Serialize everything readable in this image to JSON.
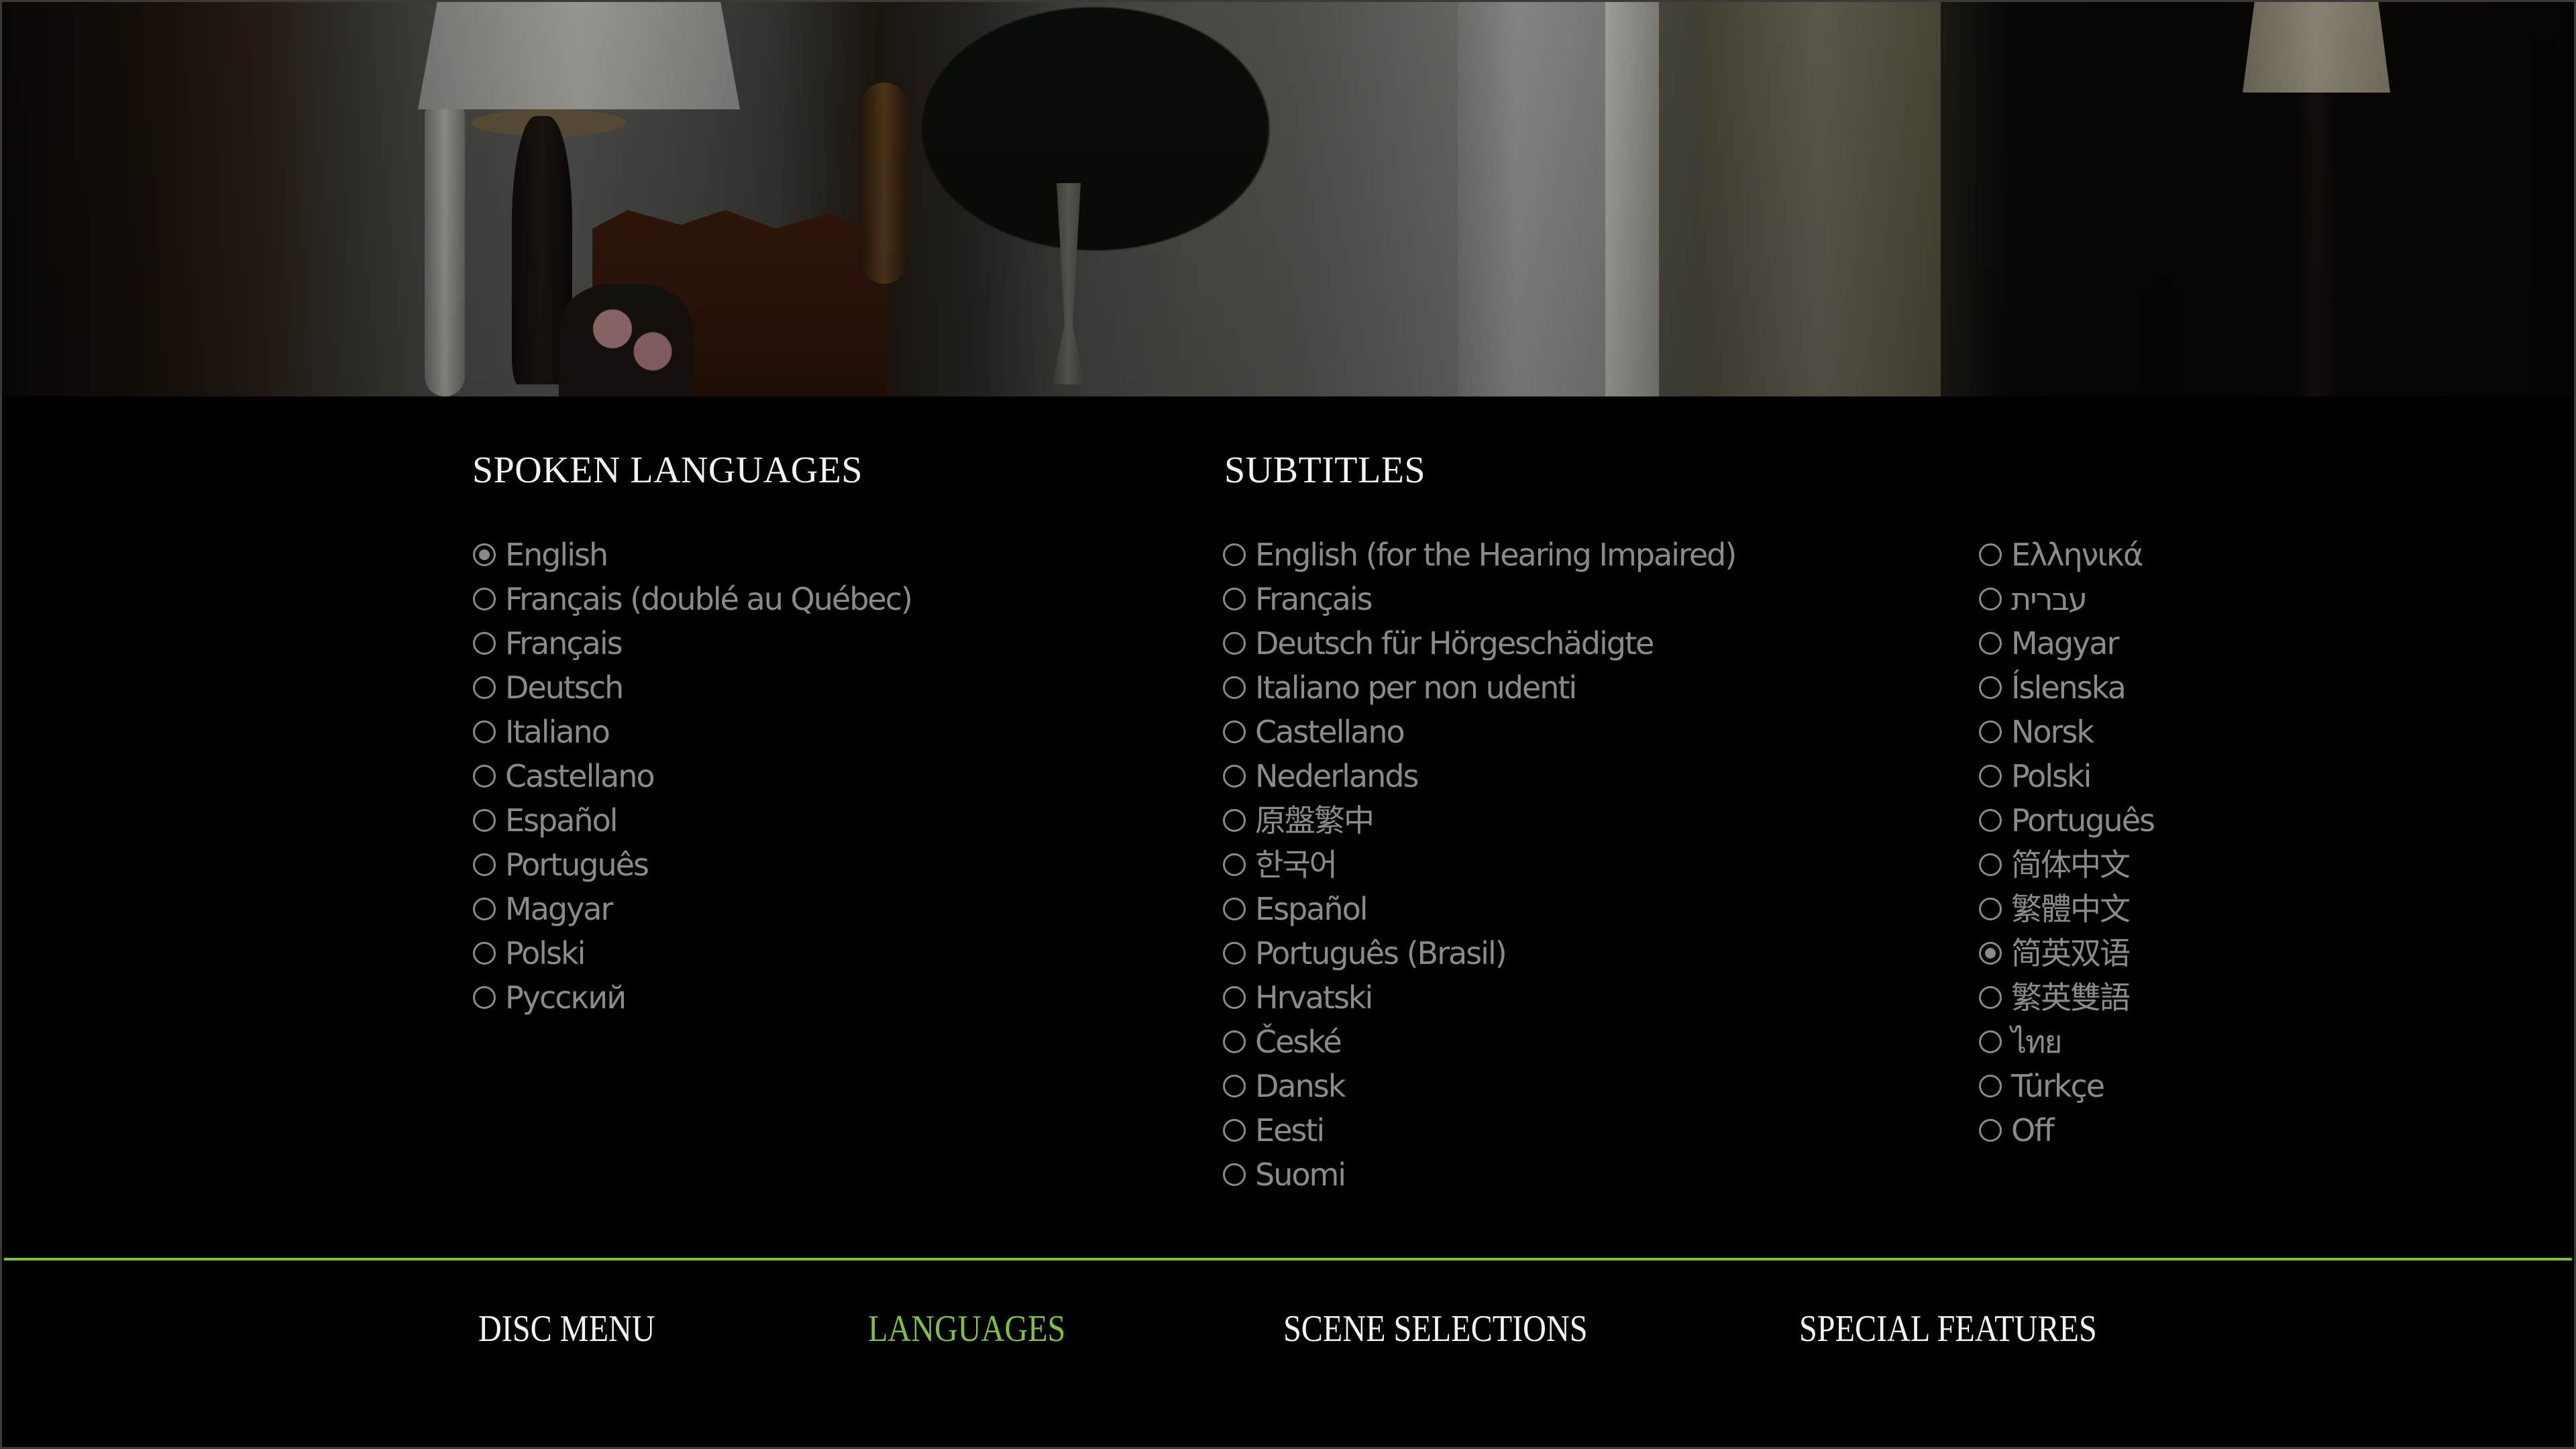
{
  "background_scene": {
    "description": "dim interior room still with lamps, chair, flowers and doorway"
  },
  "spoken_languages": {
    "title": "SPOKEN LANGUAGES",
    "selected_index": 0,
    "options": [
      {
        "label": "English",
        "selected": true
      },
      {
        "label": "Français (doublé au Québec)",
        "selected": false
      },
      {
        "label": "Français",
        "selected": false
      },
      {
        "label": "Deutsch",
        "selected": false
      },
      {
        "label": "Italiano",
        "selected": false
      },
      {
        "label": "Castellano",
        "selected": false
      },
      {
        "label": "Español",
        "selected": false
      },
      {
        "label": "Português",
        "selected": false
      },
      {
        "label": "Magyar",
        "selected": false
      },
      {
        "label": "Polski",
        "selected": false
      },
      {
        "label": "Русский",
        "selected": false
      }
    ]
  },
  "subtitles": {
    "title": "SUBTITLES",
    "selected_label": "简英双语",
    "column_a": [
      {
        "label": "English (for the Hearing Impaired)",
        "selected": false
      },
      {
        "label": "Français",
        "selected": false
      },
      {
        "label": "Deutsch für Hörgeschädigte",
        "selected": false
      },
      {
        "label": "Italiano per non udenti",
        "selected": false
      },
      {
        "label": "Castellano",
        "selected": false
      },
      {
        "label": "Nederlands",
        "selected": false
      },
      {
        "label": "原盤繁中",
        "selected": false
      },
      {
        "label": "한국어",
        "selected": false
      },
      {
        "label": "Español",
        "selected": false
      },
      {
        "label": "Português (Brasil)",
        "selected": false
      },
      {
        "label": "Hrvatski",
        "selected": false
      },
      {
        "label": "České",
        "selected": false
      },
      {
        "label": "Dansk",
        "selected": false
      },
      {
        "label": "Eesti",
        "selected": false
      },
      {
        "label": "Suomi",
        "selected": false
      }
    ],
    "column_b": [
      {
        "label": "Ελληνικά",
        "selected": false
      },
      {
        "label": "עברית",
        "selected": false
      },
      {
        "label": "Magyar",
        "selected": false
      },
      {
        "label": "Íslenska",
        "selected": false
      },
      {
        "label": "Norsk",
        "selected": false
      },
      {
        "label": "Polski",
        "selected": false
      },
      {
        "label": "Português",
        "selected": false
      },
      {
        "label": "简体中文",
        "selected": false
      },
      {
        "label": "繁體中文",
        "selected": false
      },
      {
        "label": "简英双语",
        "selected": true
      },
      {
        "label": "繁英雙語",
        "selected": false
      },
      {
        "label": "ไทย",
        "selected": false
      },
      {
        "label": "Türkçe",
        "selected": false
      },
      {
        "label": "Off",
        "selected": false
      }
    ]
  },
  "nav": {
    "active_index": 1,
    "items": [
      {
        "label": "DISC MENU",
        "active": false
      },
      {
        "label": "LANGUAGES",
        "active": true
      },
      {
        "label": "SCENE SELECTIONS",
        "active": false
      },
      {
        "label": "SPECIAL FEATURES",
        "active": false
      }
    ]
  },
  "colors": {
    "accent": "#7dc142",
    "option_text": "#8b8b8b",
    "header_text": "#f2f2f2",
    "background": "#000000"
  }
}
